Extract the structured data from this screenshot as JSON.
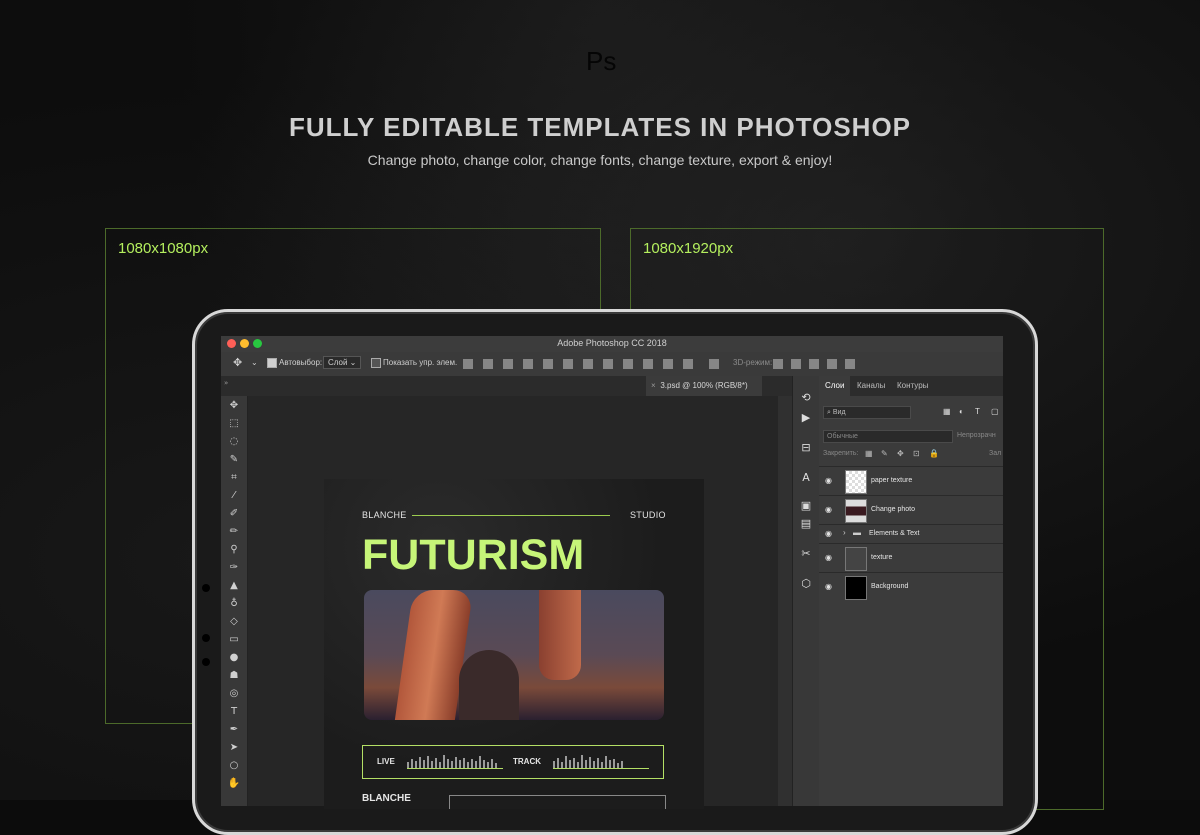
{
  "brand_mark": "Ps",
  "headline": "FULLY EDITABLE TEMPLATES IN PHOTOSHOP",
  "subheadline": "Change photo, change color, change fonts, change texture, export & enjoy!",
  "frames": [
    {
      "label": "1080x1080px"
    },
    {
      "label": "1080x1920px"
    }
  ],
  "photoshop": {
    "window_title": "Adobe Photoshop CC 2018",
    "options": {
      "auto_select_label": "Автовыбор:",
      "auto_select_value": "Слой",
      "show_controls_label": "Показать упр. элем.",
      "mode_3d_label": "3D-режим:"
    },
    "document_tab": "3.psd @ 100% (RGB/8*)",
    "panel_tabs": [
      "Слои",
      "Каналы",
      "Контуры"
    ],
    "filter_label": "Вид",
    "blend_mode": "Обычные",
    "opacity_label": "Непрозрачн",
    "lock_label": "Закрепить:",
    "fill_label": "Зал",
    "layers": [
      {
        "name": "paper texture"
      },
      {
        "name": "Change photo"
      },
      {
        "name": "Elements & Text"
      },
      {
        "name": "texture"
      },
      {
        "name": "Background"
      }
    ]
  },
  "poster": {
    "left_label": "BLANCHE",
    "right_label": "STUDIO",
    "title": "FUTURISM",
    "track_left": "LIVE",
    "track_right": "TRACK",
    "bottom_label": "BLANCHE"
  },
  "colors": {
    "accent": "#b4ef5e",
    "title_green": "#c6f578"
  }
}
